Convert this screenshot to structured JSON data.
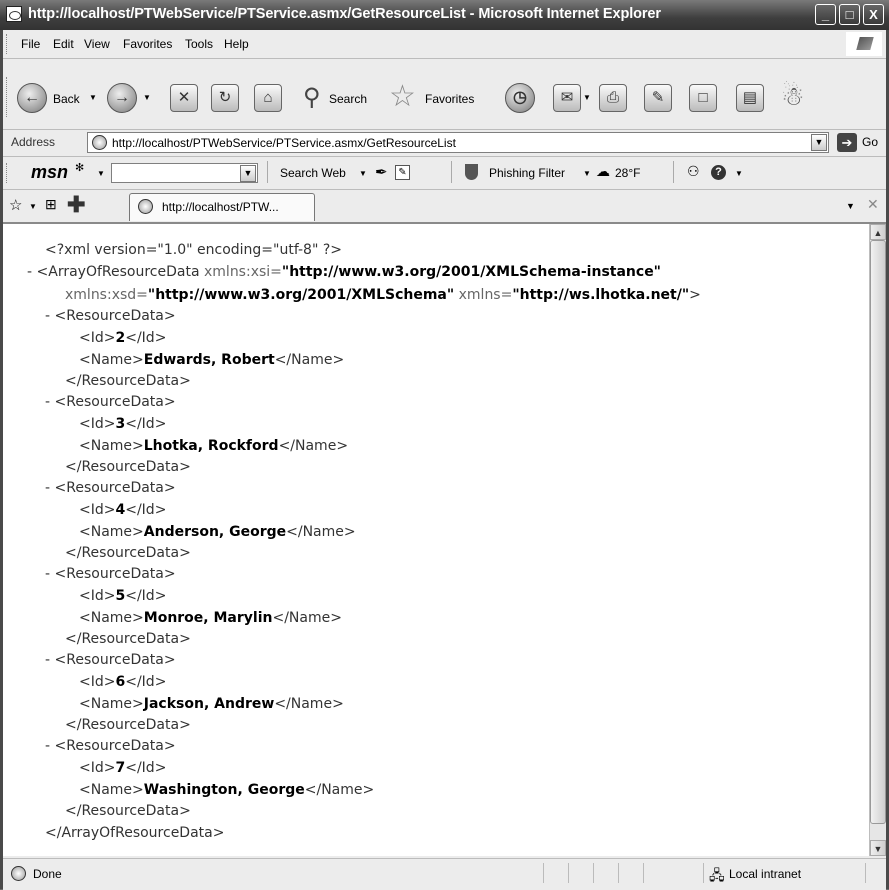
{
  "window": {
    "title": "http://localhost/PTWebService/PTService.asmx/GetResourceList - Microsoft Internet Explorer",
    "minimize": "_",
    "maximize": "□",
    "close": "X"
  },
  "menu": [
    "File",
    "Edit",
    "View",
    "Favorites",
    "Tools",
    "Help"
  ],
  "toolbar": {
    "back": "Back",
    "search": "Search",
    "favorites": "Favorites"
  },
  "address": {
    "label": "Address",
    "url": "http://localhost/PTWebService/PTService.asmx/GetResourceList",
    "go": "Go"
  },
  "msn": {
    "logo": "msn",
    "search_web": "Search Web",
    "phishing": "Phishing Filter",
    "weather": "28°F"
  },
  "tab": {
    "label": "http://localhost/PTW..."
  },
  "xml": {
    "declaration": "<?xml version=\"1.0\" encoding=\"utf-8\" ?>",
    "root_open": "<ArrayOfResourceData",
    "xmlns_xsi_attr": "xmlns:xsi=",
    "xmlns_xsi_val": "\"http://www.w3.org/2001/XMLSchema-instance\"",
    "xmlns_xsd_attr": "xmlns:xsd=",
    "xmlns_xsd_val": "\"http://www.w3.org/2001/XMLSchema\"",
    "xmlns_attr": "xmlns=",
    "xmlns_val": "\"http://ws.lhotka.net/\"",
    "root_close": "</ArrayOfResourceData>",
    "item_open": "<ResourceData>",
    "item_close": "</ResourceData>",
    "collapse": "-",
    "resources": [
      {
        "id": "2",
        "name": "Edwards, Robert"
      },
      {
        "id": "3",
        "name": "Lhotka, Rockford"
      },
      {
        "id": "4",
        "name": "Anderson, George"
      },
      {
        "id": "5",
        "name": "Monroe, Marylin"
      },
      {
        "id": "6",
        "name": "Jackson, Andrew"
      },
      {
        "id": "7",
        "name": "Washington, George"
      }
    ]
  },
  "status": {
    "text": "Done",
    "zone": "Local intranet"
  }
}
